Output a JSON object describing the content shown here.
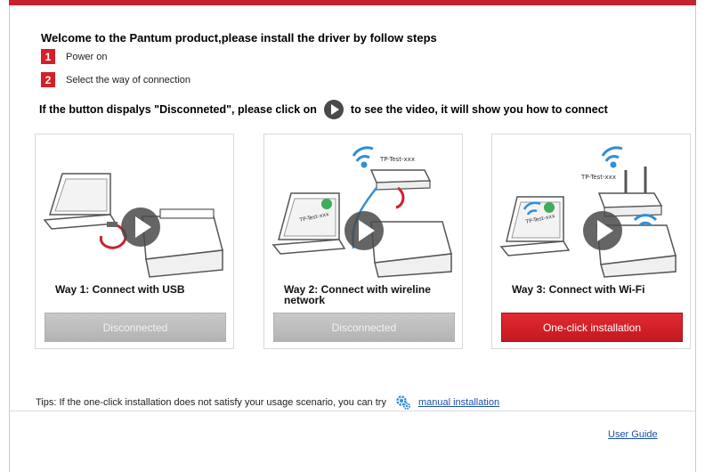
{
  "header": {
    "title": "Welcome to the Pantum product,please install the driver by follow steps"
  },
  "steps": [
    {
      "number": "1",
      "label": "Power on"
    },
    {
      "number": "2",
      "label": "Select the way of connection"
    }
  ],
  "hint": {
    "before": "If the button dispalys \"Disconneted\", please click on",
    "after": "to see the video, it will show you how to connect"
  },
  "ways": [
    {
      "title": "Way 1: Connect with USB",
      "button": "Disconnected",
      "active": false
    },
    {
      "title": "Way 2: Connect with wireline network",
      "button": "Disconnected",
      "active": false
    },
    {
      "title": "Way 3: Connect with Wi-Fi",
      "button": "One-click installation",
      "active": true
    }
  ],
  "art_labels": {
    "router_way2": "TP-Test-xxx",
    "laptop_way2": "TP-Test-xxx",
    "router_way3": "TP-Test-xxx",
    "laptop_way3": "TP-Test-xxx"
  },
  "footer": {
    "tips": "Tips: If the one-click installation does not satisfy your usage scenario, you can try",
    "manual_link": "manual installation",
    "user_guide": "User Guide"
  },
  "colors": {
    "accent_red": "#d4202a",
    "link_blue": "#1a4fa8",
    "disabled_gray": "#bdbdbd",
    "wifi_blue": "#2f8fd8"
  },
  "icons": {
    "play": "play-circle-icon",
    "gear": "gear-icon"
  }
}
